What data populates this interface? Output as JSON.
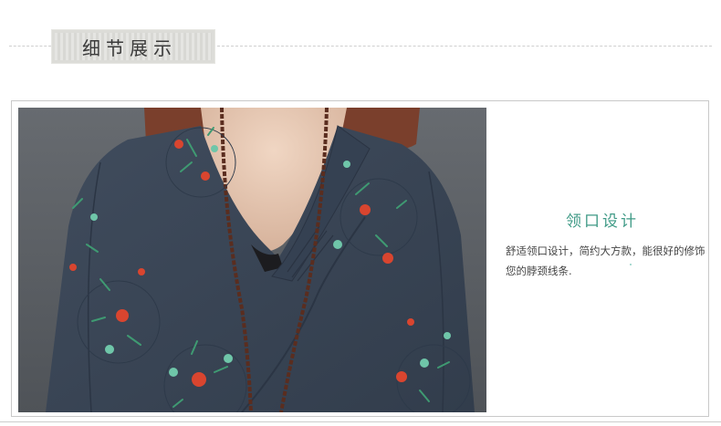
{
  "section_title": "细节展示",
  "feature": {
    "title": "领口设计",
    "description": "舒适领口设计，简约大方款，能很好的修饰您的脖颈线条."
  },
  "colors": {
    "accent": "#3f9a86",
    "garment": "#3b4758",
    "wall": "#5d6166",
    "skin": "#e7c9b4",
    "hair": "#7a3f2c",
    "cord": "#5a2d1f"
  },
  "photo": {
    "subject": "navy floral print shirt with wrap V-neck and braided cord necklace"
  }
}
